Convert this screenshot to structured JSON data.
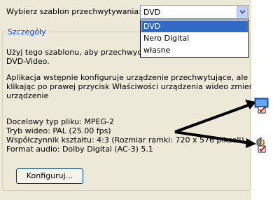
{
  "dialog": {
    "template_label": "Wybierz szablon przechwytywania:",
    "combo_value": "DVD",
    "dropdown_options": [
      "DVD",
      "Nero Digital",
      "własne"
    ],
    "group_title": "Szczegóły",
    "desc_line1": "Użyj tego szablonu, aby przechwycić w",
    "desc_line2": "DVD-Video.",
    "config_line1": "Aplikacja wstępnie konfiguruje urządzenie przechwytujące, ale",
    "config_line2": "klikając po prawej przycisk Właściwości urządzenia wideo zmień",
    "config_line3": "urządzenie",
    "target_file_type": "Docelowy typ pliku: MPEG-2",
    "video_mode": "Tryb wideo: PAL (25.00 fps)",
    "aspect_ratio": "Współczynnik kształtu: 4:3 (Rozmiar ramki: 720 x 576 pikseli)",
    "audio_format": "Format audio: Dolby Digital (AC-3) 5.1",
    "configure_button": "Konfiguruj..."
  },
  "colors": {
    "panel": "#ece9d8",
    "group_title": "#0046d5",
    "selection": "#316ac5"
  },
  "icons": [
    "chevron-down-icon",
    "video-properties-icon",
    "audio-properties-icon",
    "arrow-icon"
  ]
}
